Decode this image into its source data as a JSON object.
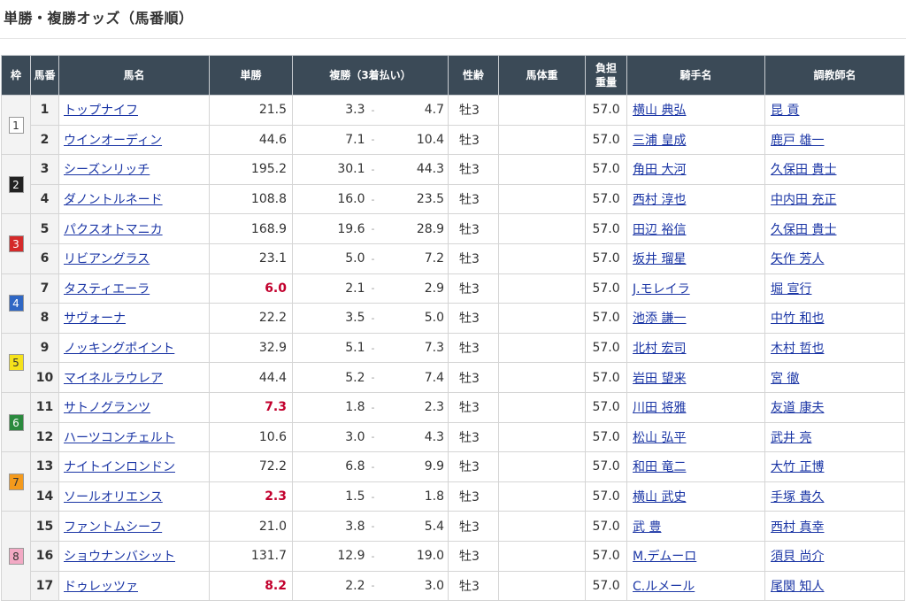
{
  "title": "単勝・複勝オッズ（馬番順）",
  "headers": {
    "waku": "枠",
    "umaban": "馬番",
    "horse": "馬名",
    "win": "単勝",
    "place": "複勝（3着払い）",
    "sexage": "性齢",
    "body_weight": "馬体重",
    "weight_1": "負担",
    "weight_2": "重量",
    "jockey": "騎手名",
    "trainer": "調教師名"
  },
  "waku_colors": {
    "1": {
      "bg": "#ffffff",
      "fg": "#333333"
    },
    "2": {
      "bg": "#222222",
      "fg": "#ffffff"
    },
    "3": {
      "bg": "#d42a2a",
      "fg": "#ffffff"
    },
    "4": {
      "bg": "#2f67c4",
      "fg": "#ffffff"
    },
    "5": {
      "bg": "#f5e21b",
      "fg": "#333333"
    },
    "6": {
      "bg": "#2b8a3e",
      "fg": "#ffffff"
    },
    "7": {
      "bg": "#f49a1c",
      "fg": "#333333"
    },
    "8": {
      "bg": "#f2a9c4",
      "fg": "#333333"
    }
  },
  "dash": "-",
  "rows": [
    {
      "waku": "1",
      "num": "1",
      "horse": "トップナイフ",
      "win": "21.5",
      "fav": false,
      "pmin": "3.3",
      "pmax": "4.7",
      "sexage": "牡3",
      "bw": "",
      "weight": "57.0",
      "jockey": "横山 典弘",
      "trainer": "昆 貢"
    },
    {
      "waku": "1",
      "num": "2",
      "horse": "ウインオーディン",
      "win": "44.6",
      "fav": false,
      "pmin": "7.1",
      "pmax": "10.4",
      "sexage": "牡3",
      "bw": "",
      "weight": "57.0",
      "jockey": "三浦 皇成",
      "trainer": "鹿戸 雄一"
    },
    {
      "waku": "2",
      "num": "3",
      "horse": "シーズンリッチ",
      "win": "195.2",
      "fav": false,
      "pmin": "30.1",
      "pmax": "44.3",
      "sexage": "牡3",
      "bw": "",
      "weight": "57.0",
      "jockey": "角田 大河",
      "trainer": "久保田 貴士"
    },
    {
      "waku": "2",
      "num": "4",
      "horse": "ダノントルネード",
      "win": "108.8",
      "fav": false,
      "pmin": "16.0",
      "pmax": "23.5",
      "sexage": "牡3",
      "bw": "",
      "weight": "57.0",
      "jockey": "西村 淳也",
      "trainer": "中内田 充正"
    },
    {
      "waku": "3",
      "num": "5",
      "horse": "パクスオトマニカ",
      "win": "168.9",
      "fav": false,
      "pmin": "19.6",
      "pmax": "28.9",
      "sexage": "牡3",
      "bw": "",
      "weight": "57.0",
      "jockey": "田辺 裕信",
      "trainer": "久保田 貴士"
    },
    {
      "waku": "3",
      "num": "6",
      "horse": "リビアングラス",
      "win": "23.1",
      "fav": false,
      "pmin": "5.0",
      "pmax": "7.2",
      "sexage": "牡3",
      "bw": "",
      "weight": "57.0",
      "jockey": "坂井 瑠星",
      "trainer": "矢作 芳人"
    },
    {
      "waku": "4",
      "num": "7",
      "horse": "タスティエーラ",
      "win": "6.0",
      "fav": true,
      "pmin": "2.1",
      "pmax": "2.9",
      "sexage": "牡3",
      "bw": "",
      "weight": "57.0",
      "jockey": "J.モレイラ",
      "trainer": "堀 宣行"
    },
    {
      "waku": "4",
      "num": "8",
      "horse": "サヴォーナ",
      "win": "22.2",
      "fav": false,
      "pmin": "3.5",
      "pmax": "5.0",
      "sexage": "牡3",
      "bw": "",
      "weight": "57.0",
      "jockey": "池添 謙一",
      "trainer": "中竹 和也"
    },
    {
      "waku": "5",
      "num": "9",
      "horse": "ノッキングポイント",
      "win": "32.9",
      "fav": false,
      "pmin": "5.1",
      "pmax": "7.3",
      "sexage": "牡3",
      "bw": "",
      "weight": "57.0",
      "jockey": "北村 宏司",
      "trainer": "木村 哲也"
    },
    {
      "waku": "5",
      "num": "10",
      "horse": "マイネルラウレア",
      "win": "44.4",
      "fav": false,
      "pmin": "5.2",
      "pmax": "7.4",
      "sexage": "牡3",
      "bw": "",
      "weight": "57.0",
      "jockey": "岩田 望来",
      "trainer": "宮 徹"
    },
    {
      "waku": "6",
      "num": "11",
      "horse": "サトノグランツ",
      "win": "7.3",
      "fav": true,
      "pmin": "1.8",
      "pmax": "2.3",
      "sexage": "牡3",
      "bw": "",
      "weight": "57.0",
      "jockey": "川田 将雅",
      "trainer": "友道 康夫"
    },
    {
      "waku": "6",
      "num": "12",
      "horse": "ハーツコンチェルト",
      "win": "10.6",
      "fav": false,
      "pmin": "3.0",
      "pmax": "4.3",
      "sexage": "牡3",
      "bw": "",
      "weight": "57.0",
      "jockey": "松山 弘平",
      "trainer": "武井 亮"
    },
    {
      "waku": "7",
      "num": "13",
      "horse": "ナイトインロンドン",
      "win": "72.2",
      "fav": false,
      "pmin": "6.8",
      "pmax": "9.9",
      "sexage": "牡3",
      "bw": "",
      "weight": "57.0",
      "jockey": "和田 竜二",
      "trainer": "大竹 正博"
    },
    {
      "waku": "7",
      "num": "14",
      "horse": "ソールオリエンス",
      "win": "2.3",
      "fav": true,
      "pmin": "1.5",
      "pmax": "1.8",
      "sexage": "牡3",
      "bw": "",
      "weight": "57.0",
      "jockey": "横山 武史",
      "trainer": "手塚 貴久"
    },
    {
      "waku": "8",
      "num": "15",
      "horse": "ファントムシーフ",
      "win": "21.0",
      "fav": false,
      "pmin": "3.8",
      "pmax": "5.4",
      "sexage": "牡3",
      "bw": "",
      "weight": "57.0",
      "jockey": "武 豊",
      "trainer": "西村 真幸"
    },
    {
      "waku": "8",
      "num": "16",
      "horse": "ショウナンバシット",
      "win": "131.7",
      "fav": false,
      "pmin": "12.9",
      "pmax": "19.0",
      "sexage": "牡3",
      "bw": "",
      "weight": "57.0",
      "jockey": "M.デムーロ",
      "trainer": "須貝 尚介"
    },
    {
      "waku": "8",
      "num": "17",
      "horse": "ドゥレッツァ",
      "win": "8.2",
      "fav": true,
      "pmin": "2.2",
      "pmax": "3.0",
      "sexage": "牡3",
      "bw": "",
      "weight": "57.0",
      "jockey": "C.ルメール",
      "trainer": "尾関 知人"
    }
  ]
}
